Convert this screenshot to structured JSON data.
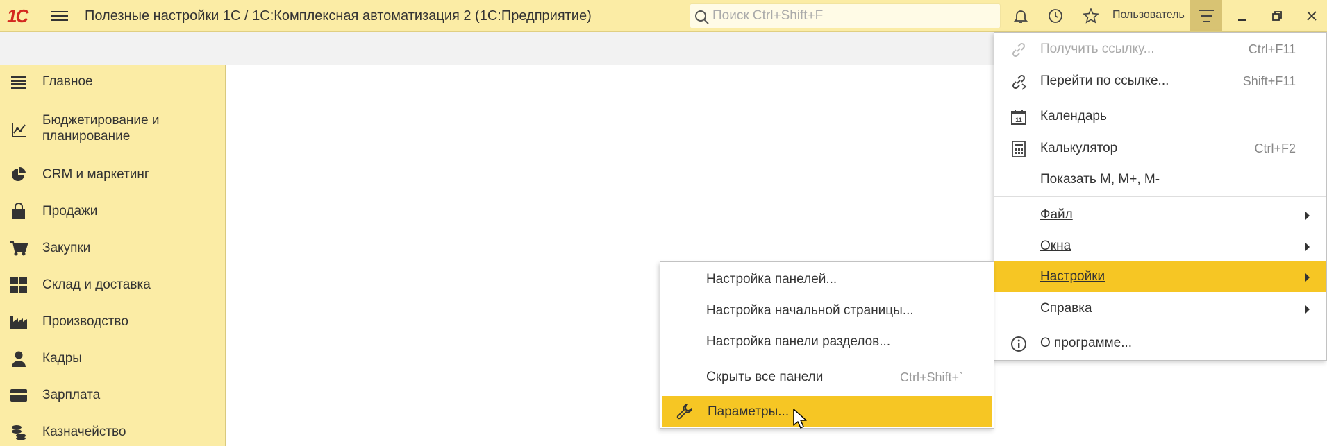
{
  "app": {
    "logo_text": "1С",
    "title": "Полезные настройки 1С / 1С:Комплексная автоматизация 2  (1С:Предприятие)"
  },
  "search": {
    "placeholder": "Поиск Ctrl+Shift+F"
  },
  "toolbar": {
    "user_label": "Пользователь"
  },
  "sidebar": {
    "items": [
      {
        "label": "Главное",
        "icon": "list-icon"
      },
      {
        "label": "Бюджетирование и планирование",
        "icon": "budget-chart-icon"
      },
      {
        "label": "CRM и маркетинг",
        "icon": "pie-chart-icon"
      },
      {
        "label": "Продажи",
        "icon": "shopping-bag-icon"
      },
      {
        "label": "Закупки",
        "icon": "cart-icon"
      },
      {
        "label": "Склад и доставка",
        "icon": "warehouse-grid-icon"
      },
      {
        "label": "Производство",
        "icon": "factory-icon"
      },
      {
        "label": "Кадры",
        "icon": "person-icon"
      },
      {
        "label": "Зарплата",
        "icon": "wallet-icon"
      },
      {
        "label": "Казначейство",
        "icon": "coins-icon"
      }
    ]
  },
  "main_menu": {
    "items": [
      {
        "label": "Получить ссылку...",
        "shortcut": "Ctrl+F11",
        "icon": "link-icon",
        "disabled": true
      },
      {
        "label": "Перейти по ссылке...",
        "shortcut": "Shift+F11",
        "icon": "follow-link-icon"
      },
      {
        "label": "Календарь",
        "shortcut": "",
        "icon": "calendar-icon",
        "icon_text": "11"
      },
      {
        "label": "Калькулятор",
        "shortcut": "Ctrl+F2",
        "icon": "calculator-icon"
      },
      {
        "label": "Показать M, M+, M-",
        "shortcut": ""
      },
      {
        "label": "Файл",
        "submenu": true
      },
      {
        "label": "Окна",
        "submenu": true
      },
      {
        "label": "Настройки",
        "submenu": true,
        "active": true
      },
      {
        "label": "Справка",
        "submenu": true
      },
      {
        "label": "О программе...",
        "icon": "info-icon"
      }
    ]
  },
  "settings_submenu": {
    "items": [
      {
        "label": "Настройка панелей..."
      },
      {
        "label": "Настройка начальной страницы..."
      },
      {
        "label": "Настройка панели разделов..."
      },
      {
        "label": "Скрыть все панели",
        "shortcut": "Ctrl+Shift+`"
      },
      {
        "label": "Параметры...",
        "icon": "wrench-icon",
        "active": true
      }
    ]
  },
  "colors": {
    "topbar": "#fbeca5",
    "sidebar": "#fbeca5",
    "highlight": "#f6c624",
    "logo": "#d3281f"
  }
}
